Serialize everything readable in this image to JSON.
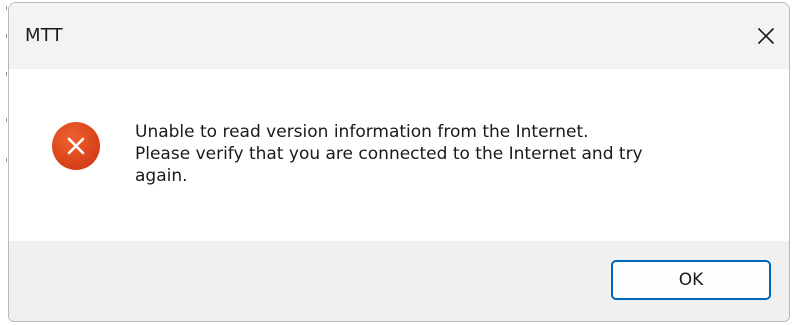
{
  "dialog": {
    "title": "MTT",
    "close_icon": "close-icon",
    "error_icon": "error-circle-x-icon",
    "accent_color": "#0067c0",
    "error_color": "#e0451b",
    "message_lines": [
      "Unable to read version information from the Internet.",
      "Please verify that you are connected to the Internet and try",
      "again."
    ],
    "ok_label": "OK"
  }
}
